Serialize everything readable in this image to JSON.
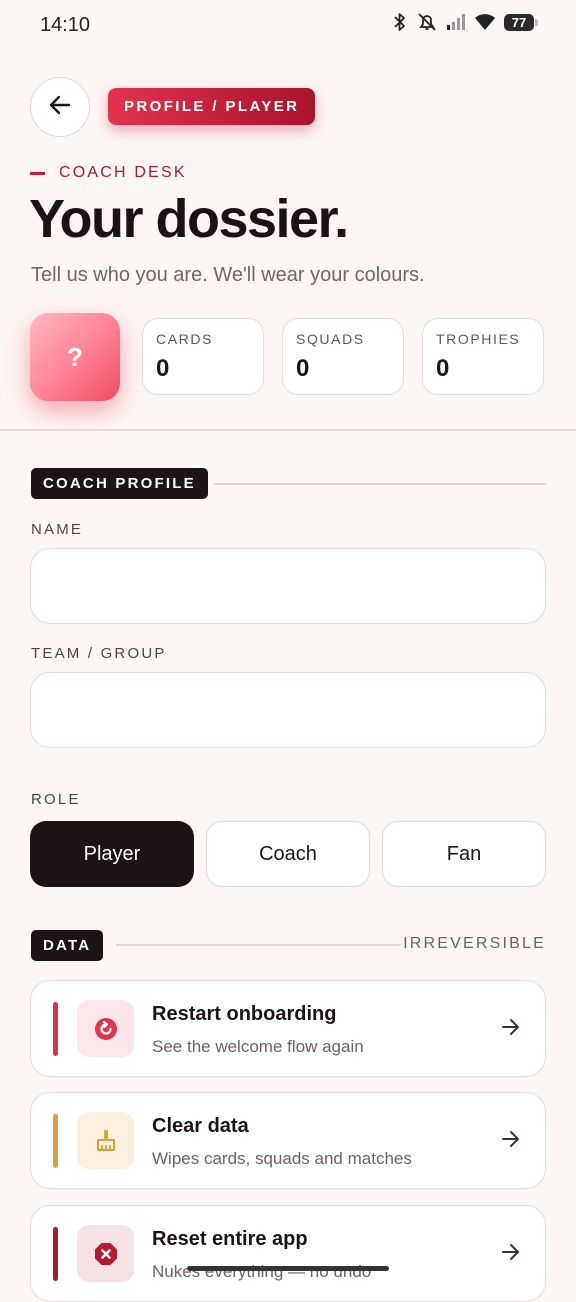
{
  "status_bar": {
    "time": "14:10",
    "battery": "77"
  },
  "header": {
    "breadcrumb": "PROFILE / PLAYER"
  },
  "hero": {
    "kicker": "COACH DESK",
    "title": "Your dossier.",
    "subtitle": "Tell us who you are. We'll wear your colours.",
    "avatar_placeholder": "?"
  },
  "stats": [
    {
      "label": "CARDS",
      "value": "0"
    },
    {
      "label": "SQUADS",
      "value": "0"
    },
    {
      "label": "TROPHIES",
      "value": "0"
    }
  ],
  "profile": {
    "section_label": "COACH PROFILE",
    "name_label": "NAME",
    "name_value": "",
    "team_label": "TEAM / GROUP",
    "team_value": "",
    "role_label": "ROLE",
    "roles": [
      "Player",
      "Coach",
      "Fan"
    ],
    "selected_role": "Player"
  },
  "data_section": {
    "section_label": "DATA",
    "note": "IRREVERSIBLE",
    "actions": [
      {
        "title": "Restart onboarding",
        "subtitle": "See the welcome flow again",
        "icon": "restart-icon",
        "accent": "#d8324b",
        "tint": "#fde6ea"
      },
      {
        "title": "Clear data",
        "subtitle": "Wipes cards, squads and matches",
        "icon": "broom-icon",
        "accent": "#d8a13a",
        "tint": "#fbf0df"
      },
      {
        "title": "Reset entire app",
        "subtitle": "Nukes everything — no undo",
        "icon": "stop-icon",
        "accent": "#a51c30",
        "tint": "#f6e2e5"
      }
    ]
  }
}
